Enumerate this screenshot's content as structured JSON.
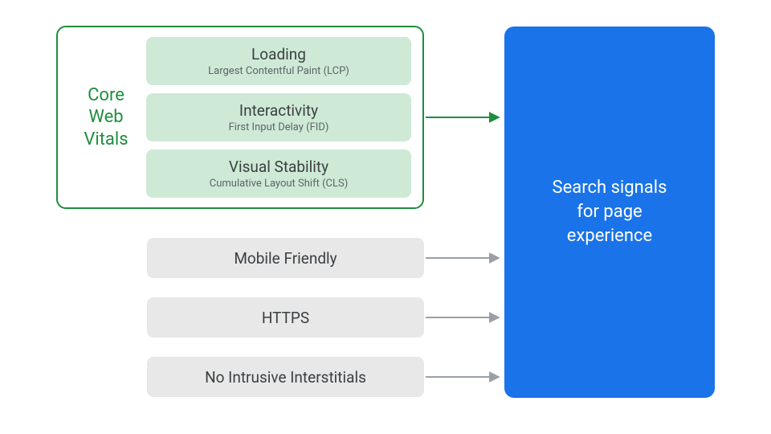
{
  "core_web_vitals": {
    "label_line1": "Core",
    "label_line2": "Web",
    "label_line3": "Vitals",
    "items": [
      {
        "title": "Loading",
        "subtitle": "Largest Contentful Paint (LCP)"
      },
      {
        "title": "Interactivity",
        "subtitle": "First Input Delay (FID)"
      },
      {
        "title": "Visual Stability",
        "subtitle": "Cumulative Layout Shift (CLS)"
      }
    ]
  },
  "other_signals": [
    {
      "label": "Mobile Friendly"
    },
    {
      "label": "HTTPS"
    },
    {
      "label": "No Intrusive Interstitials"
    }
  ],
  "target_box": {
    "line1": "Search signals",
    "line2": "for page",
    "line3": "experience"
  },
  "colors": {
    "green": "#1e8e3e",
    "green_fill": "#ceead6",
    "blue": "#1a73e8",
    "gray_fill": "#e8e8e8",
    "arrow_gray": "#9aa0a6",
    "text_primary": "#3c4043",
    "text_secondary": "#5f6368"
  }
}
